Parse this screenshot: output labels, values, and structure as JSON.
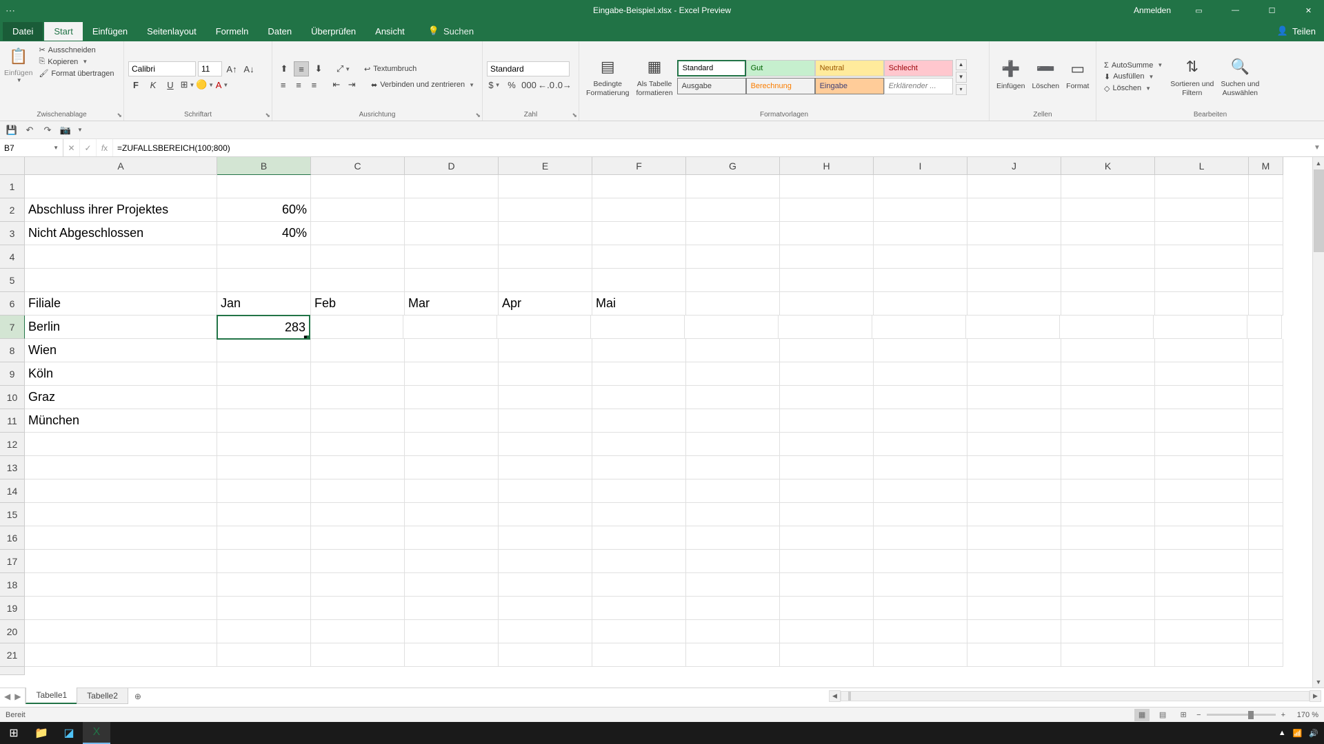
{
  "title": "Eingabe-Beispiel.xlsx - Excel Preview",
  "titlebar": {
    "signin": "Anmelden"
  },
  "tabs": {
    "file": "Datei",
    "home": "Start",
    "insert": "Einfügen",
    "pagelayout": "Seitenlayout",
    "formulas": "Formeln",
    "data": "Daten",
    "review": "Überprüfen",
    "view": "Ansicht",
    "search": "Suchen",
    "share": "Teilen"
  },
  "ribbon": {
    "clipboard": {
      "paste": "Einfügen",
      "cut": "Ausschneiden",
      "copy": "Kopieren",
      "format": "Format übertragen",
      "label": "Zwischenablage"
    },
    "font": {
      "name": "Calibri",
      "size": "11",
      "label": "Schriftart"
    },
    "alignment": {
      "wrap": "Textumbruch",
      "merge": "Verbinden und zentrieren",
      "label": "Ausrichtung"
    },
    "number": {
      "format": "Standard",
      "label": "Zahl"
    },
    "styles": {
      "conditional": "Bedingte\nFormatierung",
      "astable": "Als Tabelle\nformatieren",
      "normal": "Standard",
      "good": "Gut",
      "neutral": "Neutral",
      "bad": "Schlecht",
      "output": "Ausgabe",
      "calc": "Berechnung",
      "input": "Eingabe",
      "explain": "Erklärender ...",
      "label": "Formatvorlagen"
    },
    "cells": {
      "insert": "Einfügen",
      "delete": "Löschen",
      "format": "Format",
      "label": "Zellen"
    },
    "editing": {
      "autosum": "AutoSumme",
      "fill": "Ausfüllen",
      "clear": "Löschen",
      "sort": "Sortieren und\nFiltern",
      "find": "Suchen und\nAuswählen",
      "label": "Bearbeiten"
    }
  },
  "formula_bar": {
    "cell_ref": "B7",
    "formula": "=ZUFALLSBEREICH(100;800)"
  },
  "columns": [
    "A",
    "B",
    "C",
    "D",
    "E",
    "F",
    "G",
    "H",
    "I",
    "J",
    "K",
    "L",
    "M"
  ],
  "selected_col": "B",
  "selected_row": 7,
  "cells": {
    "A2": "Abschluss ihrer Projektes",
    "B2": "60%",
    "A3": "Nicht Abgeschlossen",
    "B3": "40%",
    "A6": "Filiale",
    "B6": "Jan",
    "C6": "Feb",
    "D6": "Mar",
    "E6": "Apr",
    "F6": "Mai",
    "A7": "Berlin",
    "B7": "283",
    "A8": "Wien",
    "A9": "Köln",
    "A10": "Graz",
    "A11": "München"
  },
  "sheets": {
    "tab1": "Tabelle1",
    "tab2": "Tabelle2"
  },
  "status": {
    "ready": "Bereit",
    "zoom": "170 %"
  },
  "chart_data": {
    "type": "table",
    "title": "Filiale monthly data (incomplete)",
    "columns": [
      "Filiale",
      "Jan",
      "Feb",
      "Mar",
      "Apr",
      "Mai"
    ],
    "rows": [
      {
        "Filiale": "Berlin",
        "Jan": 283
      },
      {
        "Filiale": "Wien"
      },
      {
        "Filiale": "Köln"
      },
      {
        "Filiale": "Graz"
      },
      {
        "Filiale": "München"
      }
    ],
    "summary": {
      "Abschluss ihrer Projektes": "60%",
      "Nicht Abgeschlossen": "40%"
    }
  }
}
